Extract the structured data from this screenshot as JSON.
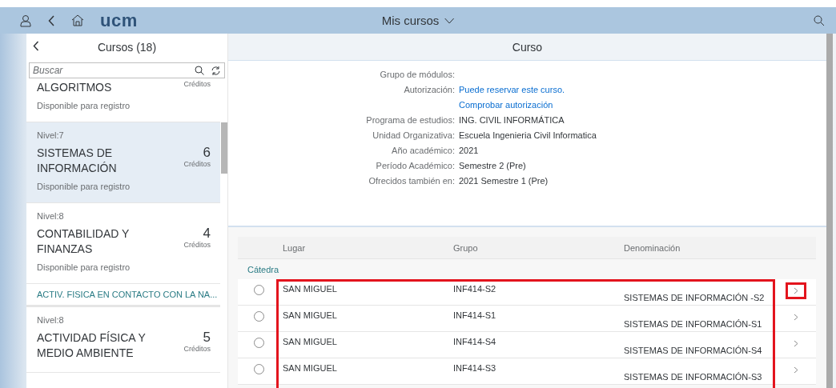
{
  "header": {
    "title": "Mis cursos",
    "logo": "ucm"
  },
  "sidebar": {
    "title": "Cursos (18)",
    "search": {
      "placeholder": "Buscar"
    },
    "items": [
      {
        "kind": "course",
        "title": "ALGORITMOS",
        "credits_label": "Créditos",
        "status": "Disponible para registro",
        "selected": false
      },
      {
        "kind": "course",
        "level": "Nivel:7",
        "title": "SISTEMAS DE INFORMACIÓN",
        "credits": "6",
        "credits_label": "Créditos",
        "status": "Disponible para registro",
        "selected": true
      },
      {
        "kind": "course",
        "level": "Nivel:8",
        "title": "CONTABILIDAD Y FINANZAS",
        "credits": "4",
        "credits_label": "Créditos",
        "status": "Disponible para registro",
        "selected": false
      },
      {
        "kind": "group",
        "title": "ACTIV. FISICA EN CONTACTO CON LA NA..."
      },
      {
        "kind": "course",
        "level": "Nivel:8",
        "title": "ACTIVIDAD FÍSICA Y MEDIO AMBIENTE",
        "credits": "5",
        "credits_label": "Créditos",
        "selected": false
      }
    ]
  },
  "detail": {
    "title": "Curso",
    "fields": [
      {
        "label": "Grupo de módulos:"
      },
      {
        "label": "Autorización:",
        "value": "Puede reservar este curso.",
        "kind": "link"
      },
      {
        "value": "Comprobar autorización",
        "kind": "link"
      },
      {
        "label": "Programa de estudios:",
        "value": "ING. CIVIL INFORMÁTICA",
        "kind": "text"
      },
      {
        "label": "Unidad Organizativa:",
        "value": "Escuela Ingenieria Civil Informatica",
        "kind": "text"
      },
      {
        "label": "Año académico:",
        "value": "2021",
        "kind": "text"
      },
      {
        "label": "Período Académico:",
        "value": "Semestre 2 (Pre)",
        "kind": "text"
      },
      {
        "label": "Ofrecidos también en:",
        "value": "2021 Semestre 1 (Pre)",
        "kind": "text"
      }
    ]
  },
  "table": {
    "columns": [
      "Lugar",
      "Grupo",
      "Denominación"
    ],
    "group": "Cátedra",
    "highlight": true,
    "rows": [
      {
        "lugar": "SAN MIGUEL",
        "grupo": "INF414-S2",
        "denominacion": "SISTEMAS DE INFORMACIÓN -S2",
        "selected": false,
        "arrow_highlighted": true
      },
      {
        "lugar": "SAN MIGUEL",
        "grupo": "INF414-S1",
        "denominacion": "SISTEMAS DE INFORMACIÓN-S1",
        "selected": false,
        "arrow_highlighted": false
      },
      {
        "lugar": "SAN MIGUEL",
        "grupo": "INF414-S4",
        "denominacion": "SISTEMAS DE INFORMACIÓN-S4",
        "selected": false,
        "arrow_highlighted": false
      },
      {
        "lugar": "SAN MIGUEL",
        "grupo": "INF414-S3",
        "denominacion": "SISTEMAS DE INFORMACIÓN-S3",
        "selected": false,
        "arrow_highlighted": false
      }
    ]
  }
}
